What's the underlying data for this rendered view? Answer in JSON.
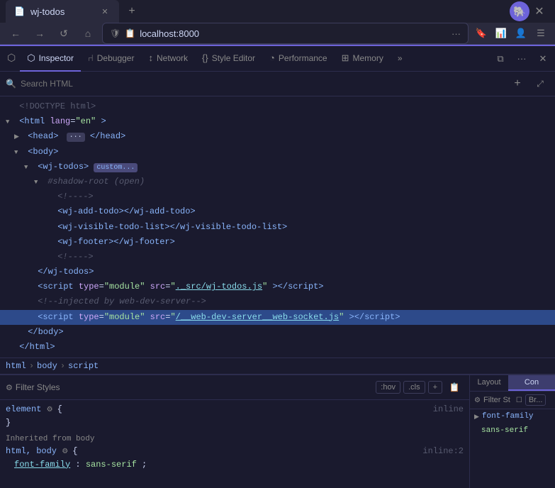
{
  "browser": {
    "tab_title": "wj-todos",
    "url": "localhost:8000",
    "new_tab_label": "+",
    "close_label": "✕"
  },
  "devtools": {
    "tabs": [
      {
        "id": "inspector",
        "label": "Inspector",
        "icon": "⬡",
        "active": true
      },
      {
        "id": "debugger",
        "label": "Debugger",
        "icon": "⑁"
      },
      {
        "id": "network",
        "label": "Network",
        "icon": "↕"
      },
      {
        "id": "style-editor",
        "label": "Style Editor",
        "icon": "{}"
      },
      {
        "id": "performance",
        "label": "Performance",
        "icon": "◔"
      },
      {
        "id": "memory",
        "label": "Memory",
        "icon": "⊞"
      }
    ],
    "more_tabs_label": "»"
  },
  "html_panel": {
    "search_placeholder": "Search HTML",
    "lines": [
      {
        "id": "doctype",
        "indent": 0,
        "content": "<!DOCTYPE html>",
        "type": "doctype"
      },
      {
        "id": "html-open",
        "indent": 0,
        "content": "<html lang=\"en\">",
        "type": "tag",
        "triangle": "open"
      },
      {
        "id": "head",
        "indent": 1,
        "content": "<head>",
        "type": "tag",
        "triangle": "closed",
        "has_badge": true
      },
      {
        "id": "body-open",
        "indent": 1,
        "content": "<body>",
        "type": "tag",
        "triangle": "open"
      },
      {
        "id": "wj-todos",
        "indent": 2,
        "content": "<wj-todos>",
        "type": "tag",
        "triangle": "open",
        "has_custom": true
      },
      {
        "id": "shadow-root",
        "indent": 3,
        "content": "#shadow-root (open)",
        "type": "comment"
      },
      {
        "id": "comment1",
        "indent": 4,
        "content": "<!---->",
        "type": "comment"
      },
      {
        "id": "wj-add-todo",
        "indent": 4,
        "content": "<wj-add-todo></wj-add-todo>",
        "type": "tag"
      },
      {
        "id": "wj-visible",
        "indent": 4,
        "content": "<wj-visible-todo-list></wj-visible-todo-list>",
        "type": "tag"
      },
      {
        "id": "wj-footer",
        "indent": 4,
        "content": "<wj-footer></wj-footer>",
        "type": "tag"
      },
      {
        "id": "comment2",
        "indent": 4,
        "content": "<!---->",
        "type": "comment"
      },
      {
        "id": "wj-todos-close",
        "indent": 2,
        "content": "</wj-todos>",
        "type": "tag"
      },
      {
        "id": "script1",
        "indent": 2,
        "content": "<script type=\"module\" src=\"./_src/wj-todos.js\"></script>",
        "type": "tag"
      },
      {
        "id": "comment3",
        "indent": 2,
        "content": "<!--injected by web-dev-server-->",
        "type": "comment"
      },
      {
        "id": "script2",
        "indent": 2,
        "content": "<script type=\"module\" src=\"/__web-dev-server__web-socket.js\"></script>",
        "type": "tag",
        "selected": true
      },
      {
        "id": "body-close",
        "indent": 1,
        "content": "</body>",
        "type": "tag"
      },
      {
        "id": "html-close",
        "indent": 0,
        "content": "</html>",
        "type": "tag"
      }
    ]
  },
  "breadcrumb": {
    "items": [
      "html",
      "body",
      "script"
    ]
  },
  "styles_panel": {
    "filter_label": "Filter Styles",
    "hov_label": ":hov",
    "cls_label": ".cls",
    "add_label": "+",
    "rules": [
      {
        "selector": "element",
        "has_gear": true,
        "open_brace": "{",
        "close_brace": "}",
        "source": "inline"
      }
    ],
    "inherited_label": "Inherited from body",
    "inherited_rules": [
      {
        "selector": "html, body",
        "has_gear": true,
        "open_brace": "{",
        "source": "inline:2",
        "properties": [
          {
            "name": "font-family",
            "value": "sans-serif",
            "is_link": true
          }
        ]
      }
    ]
  },
  "right_panel": {
    "layout_tab": "Layout",
    "con_tab": "Con",
    "filter_st_label": "Filter St",
    "br_label": "Br...",
    "font_family_label": "font-family",
    "font_value": "sans-serif"
  }
}
